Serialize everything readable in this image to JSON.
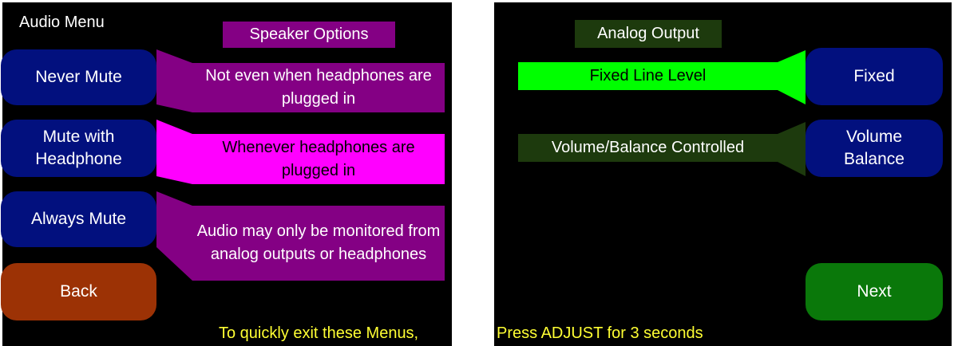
{
  "left": {
    "title": "Audio Menu",
    "header": "Speaker Options",
    "buttons": {
      "never_mute": "Never Mute",
      "mute_headphone": "Mute with Headphone",
      "always_mute": "Always Mute",
      "back": "Back"
    },
    "descriptions": {
      "never_mute": "Not even when headphones are plugged in",
      "mute_headphone": "Whenever headphones are plugged in",
      "always_mute": "Audio may only be monitored from analog outputs or headphones"
    },
    "selected": "Mute with Headphone",
    "footer": "To quickly exit these Menus,"
  },
  "right": {
    "header": "Analog Output",
    "buttons": {
      "fixed": "Fixed",
      "volume_balance": "Volume Balance",
      "next": "Next"
    },
    "descriptions": {
      "fixed": "Fixed Line Level",
      "volume_balance": "Volume/Balance Controlled"
    },
    "selected": "Fixed",
    "footer": "Press ADJUST for 3 seconds"
  },
  "colors": {
    "background": "#000000",
    "button": "#02107e",
    "back_button": "#9c3205",
    "next_button": "#0a780a",
    "speaker_dim": "#840084",
    "speaker_selected": "#ff00ff",
    "analog_dim": "#1d3a0d",
    "analog_selected": "#00ff00",
    "footer_text": "#ffff33"
  }
}
